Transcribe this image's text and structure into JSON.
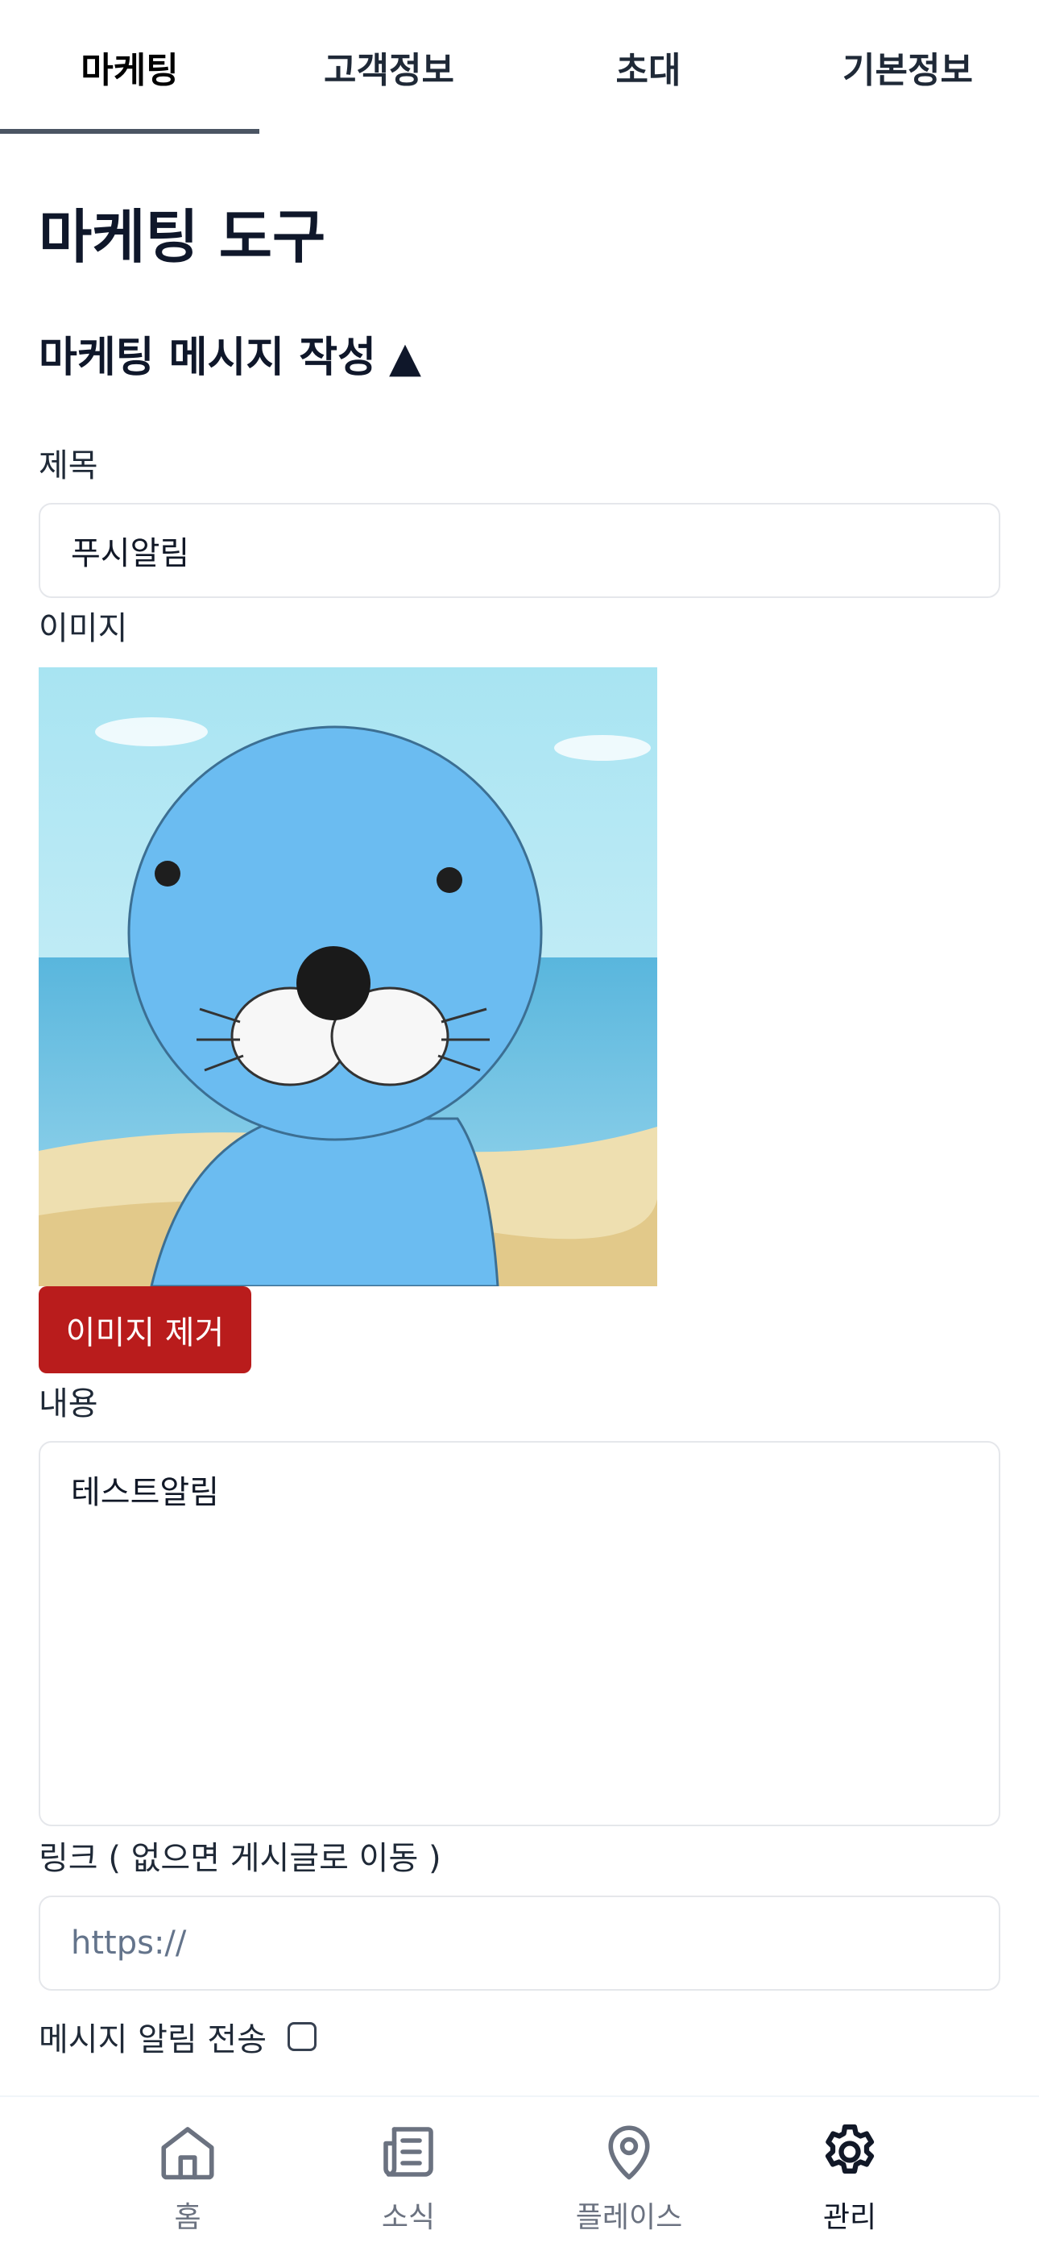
{
  "tabs": [
    {
      "label": "마케팅",
      "active": true
    },
    {
      "label": "고객정보",
      "active": false
    },
    {
      "label": "초대",
      "active": false
    },
    {
      "label": "기본정보",
      "active": false
    }
  ],
  "page_title": "마케팅 도구",
  "section": {
    "title": "마케팅 메시지 작성",
    "toggle_icon": "▲"
  },
  "form": {
    "title_label": "제목",
    "title_value": "푸시알림",
    "image_label": "이미지",
    "remove_image_label": "이미지 제거",
    "content_label": "내용",
    "content_value": "테스트알림",
    "link_label": "링크 ( 없으면 게시글로 이동 )",
    "link_placeholder": "https://",
    "notify_label": "메시지 알림 전송",
    "notify_checked": false
  },
  "bottom_nav": [
    {
      "label": "홈",
      "icon": "home-icon",
      "active": false
    },
    {
      "label": "소식",
      "icon": "news-icon",
      "active": false
    },
    {
      "label": "플레이스",
      "icon": "location-pin-icon",
      "active": false
    },
    {
      "label": "관리",
      "icon": "gear-icon",
      "active": true
    }
  ],
  "colors": {
    "remove_button": "#b91c1c",
    "active_tab_underline": "#4b5563",
    "field_border": "#e5e7eb"
  }
}
